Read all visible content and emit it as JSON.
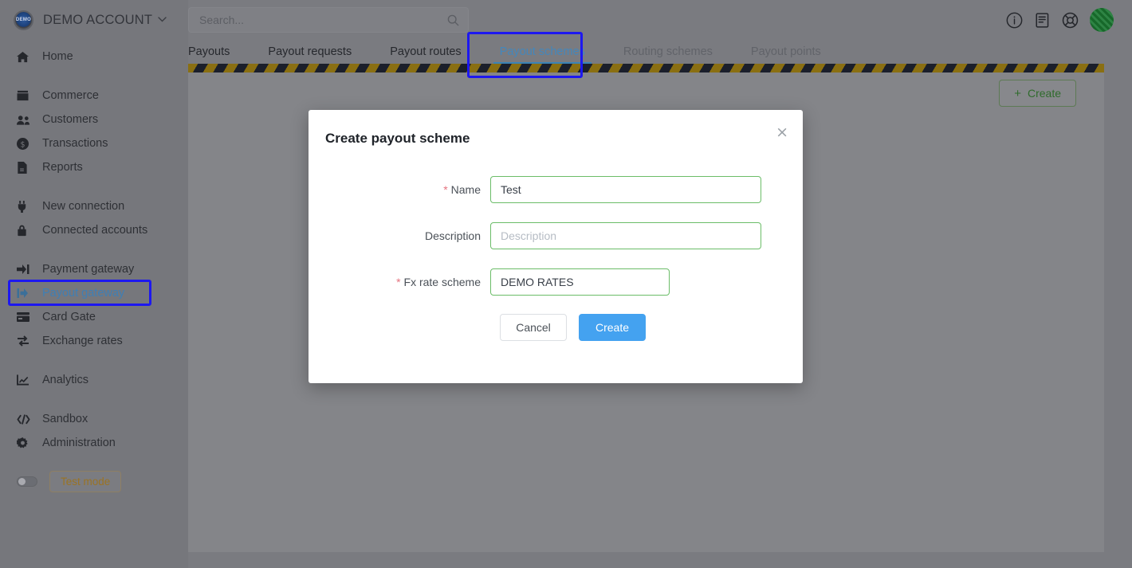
{
  "brand": {
    "logo_text": "DEMO",
    "name": "DEMO ACCOUNT",
    "caret": "⌄",
    "logo_icon": "account-logo-icon"
  },
  "search": {
    "placeholder": "Search...",
    "value": "",
    "icon": "search-icon"
  },
  "topbar": {
    "icons": [
      {
        "name": "info-icon",
        "label": "Info"
      },
      {
        "name": "documentation-icon",
        "label": "Documentation"
      },
      {
        "name": "support-lifebuoy-icon",
        "label": "Support"
      }
    ],
    "avatar": {
      "name": "user-avatar",
      "label": "User"
    }
  },
  "sidebar": {
    "groups": [
      {
        "items": [
          {
            "label": "Home",
            "icon": "home-icon",
            "active": false
          }
        ]
      },
      {
        "items": [
          {
            "label": "Commerce",
            "icon": "store-icon",
            "active": false
          },
          {
            "label": "Customers",
            "icon": "users-icon",
            "active": false
          },
          {
            "label": "Transactions",
            "icon": "dollar-circle-icon",
            "active": false
          },
          {
            "label": "Reports",
            "icon": "report-document-icon",
            "active": false
          }
        ]
      },
      {
        "items": [
          {
            "label": "New connection",
            "icon": "plug-icon",
            "active": false
          },
          {
            "label": "Connected accounts",
            "icon": "lock-icon",
            "active": false
          }
        ]
      },
      {
        "items": [
          {
            "label": "Payment gateway",
            "icon": "sign-in-arrow-icon",
            "active": false
          },
          {
            "label": "Payout gateway",
            "icon": "sign-out-arrow-icon",
            "active": true
          },
          {
            "label": "Card Gate",
            "icon": "credit-card-icon",
            "active": false
          },
          {
            "label": "Exchange rates",
            "icon": "exchange-arrows-icon",
            "active": false
          }
        ]
      },
      {
        "items": [
          {
            "label": "Analytics",
            "icon": "chart-line-icon",
            "active": false
          }
        ]
      },
      {
        "items": [
          {
            "label": "Sandbox",
            "icon": "code-brackets-icon",
            "active": false
          },
          {
            "label": "Administration",
            "icon": "gear-icon",
            "active": false
          }
        ]
      }
    ],
    "test_mode": {
      "toggle_name": "test-mode-toggle",
      "label": "Test mode",
      "enabled": false
    }
  },
  "tabs": [
    {
      "label": "Payouts",
      "state": "normal"
    },
    {
      "label": "Payout requests",
      "state": "normal"
    },
    {
      "label": "Payout routes",
      "state": "normal"
    },
    {
      "label": "Payout schemes",
      "state": "active"
    },
    {
      "label": "Routing schemes",
      "state": "dim"
    },
    {
      "label": "Payout points",
      "state": "dim"
    }
  ],
  "content": {
    "create_button": {
      "plus": "+",
      "label": "Create"
    }
  },
  "modal": {
    "title": "Create payout scheme",
    "close_icon": "×",
    "fields": [
      {
        "required": true,
        "required_mark": "*",
        "label": "Name",
        "value": "Test",
        "placeholder": ""
      },
      {
        "required": false,
        "required_mark": "",
        "label": "Description",
        "value": "",
        "placeholder": "Description"
      },
      {
        "required": true,
        "required_mark": "*",
        "label": "Fx rate scheme",
        "value": "DEMO RATES",
        "placeholder": ""
      }
    ],
    "cancel_label": "Cancel",
    "create_label": "Create"
  },
  "colors": {
    "accent_blue": "#44a2f0",
    "annotation_blue": "#1d18f0",
    "input_border_green": "#6bbd68",
    "required_red": "#e5737f",
    "active_tab": "#4487bb",
    "hazard_yellow": "#8a6f12",
    "hazard_dark": "#1b1f2b",
    "test_mode_orange": "#9a7324",
    "create_green": "#2f6b2c"
  }
}
